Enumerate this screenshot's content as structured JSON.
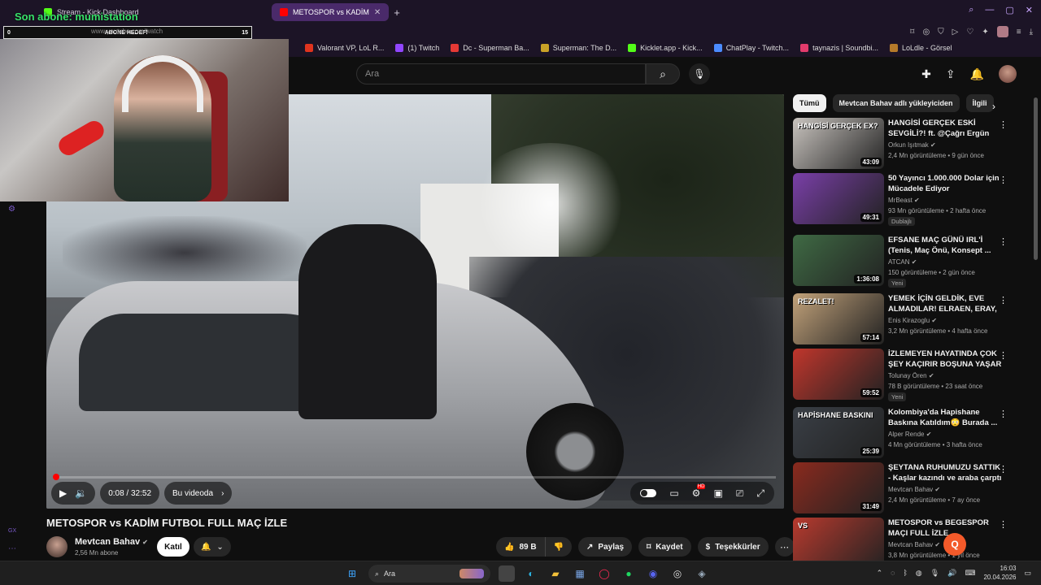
{
  "browser": {
    "tabs": [
      {
        "label": "Stream - Kick Dashboard",
        "favicon_color": "#53fc18",
        "active": false
      },
      {
        "label": "METOSPOR vs KADİM",
        "favicon_color": "#ff0000",
        "active": true
      }
    ],
    "new_tab": "+",
    "address": "www.youtube.com/watch",
    "bookmarks": [
      {
        "label": "Valorant VP, LoL R...",
        "color": "#e0341e"
      },
      {
        "label": "(1) Twitch",
        "color": "#9146ff"
      },
      {
        "label": "Dc - Superman Ba...",
        "color": "#e53935"
      },
      {
        "label": "Superman: The D...",
        "color": "#c9a227"
      },
      {
        "label": "Kicklet.app - Kick...",
        "color": "#53fc18"
      },
      {
        "label": "ChatPlay - Twitch...",
        "color": "#4b8bff"
      },
      {
        "label": "taynazis | Soundbi...",
        "color": "#e23b6c"
      },
      {
        "label": "LoLdle - Görsel",
        "color": "#b57a2a"
      }
    ]
  },
  "stream_overlay": {
    "sub_label": "Son abone: mumistation",
    "goal_start": "0",
    "goal_title": "ABONE HEDEFİ",
    "goal_end": "15",
    "goal_progress": 0.0
  },
  "youtube": {
    "search_placeholder": "Ara",
    "video": {
      "title": "METOSPOR vs KADİM FUTBOL FULL MAÇ İZLE",
      "time_current": "0:08",
      "time_total": "32:52",
      "time_display": "0:08 / 32:52",
      "chapter_label": "Bu videoda",
      "progress": 0.004
    },
    "channel": {
      "name": "Mevtcan Bahav",
      "subscribers": "2,56 Mn abone",
      "join_label": "Katıl"
    },
    "actions": {
      "likes": "89 B",
      "share": "Paylaş",
      "save": "Kaydet",
      "thanks": "Teşekkürler"
    },
    "chips": [
      "Tümü",
      "Mevtcan Bahav adlı yükleyiciden",
      "İlgili"
    ],
    "recommendations": [
      {
        "title": "HANGİSİ GERÇEK ESKİ SEVGİLİ?! ft. @Çağrı Ergün",
        "channel": "Orkun Işıtmak",
        "meta": "2,4 Mn görüntüleme • 9 gün önce",
        "duration": "43:09",
        "thumb_text": "HANGİSİ GERÇEK EX?",
        "thumb_color": "#c9c4bf",
        "badge": ""
      },
      {
        "title": "50 Yayıncı 1.000.000 Dolar için Mücadele Ediyor",
        "channel": "MrBeast",
        "meta": "93 Mn görüntüleme • 2 hafta önce",
        "duration": "49:31",
        "thumb_text": "",
        "thumb_color": "#7a3fa8",
        "badge": "Dublajlı"
      },
      {
        "title": "EFSANE MAÇ GÜNÜ IRL'İ (Tenis, Maç Önü, Konsept ...",
        "channel": "ATCAN",
        "meta": "150 görüntüleme • 2 gün önce",
        "duration": "1:36:08",
        "thumb_text": "",
        "thumb_color": "#3f6a44",
        "badge": "Yeni"
      },
      {
        "title": "YEMEK İÇİN GELDİK, EVE ALMADILAR! ELRAEN, ERAY, ...",
        "channel": "Enis Kirazoglu",
        "meta": "3,2 Mn görüntüleme • 4 hafta önce",
        "duration": "57:14",
        "thumb_text": "REZALET!",
        "thumb_color": "#c2a27a",
        "badge": ""
      },
      {
        "title": "İZLEMEYEN HAYATINDA ÇOK ŞEY KAÇIRIR BOŞUNA YAŞAR ...",
        "channel": "Tolunay Ören",
        "meta": "78 B görüntüleme • 23 saat önce",
        "duration": "59:52",
        "thumb_text": "",
        "thumb_color": "#c0362c",
        "badge": "Yeni"
      },
      {
        "title": "Kolombiya'da Hapishane Baskına Katıldım😳 Burada ...",
        "channel": "Alper Rende",
        "meta": "4 Mn görüntüleme • 3 hafta önce",
        "duration": "25:39",
        "thumb_text": "HAPİSHANE BASKINI",
        "thumb_color": "#3a3f46",
        "badge": ""
      },
      {
        "title": "ŞEYTANA RUHUMUZU SATTIK - Kaşlar kazındı ve araba çarptı ...",
        "channel": "Mevtcan Bahav",
        "meta": "2,4 Mn görüntüleme • 7 ay önce",
        "duration": "31:49",
        "thumb_text": "",
        "thumb_color": "#8a2a1e",
        "badge": ""
      },
      {
        "title": "METOSPOR vs BEGESPOR MAÇI FULL İZLE",
        "channel": "Mevtcan Bahav",
        "meta": "3,8 Mn görüntüleme • 1 yıl önce",
        "duration": "",
        "thumb_text": "VS",
        "thumb_color": "#b83a2e",
        "badge": ""
      }
    ]
  },
  "taskbar": {
    "search_label": "Ara",
    "time": "16:03",
    "date": "20.04.2026"
  },
  "left_rail": {
    "gx_label": "GX"
  }
}
